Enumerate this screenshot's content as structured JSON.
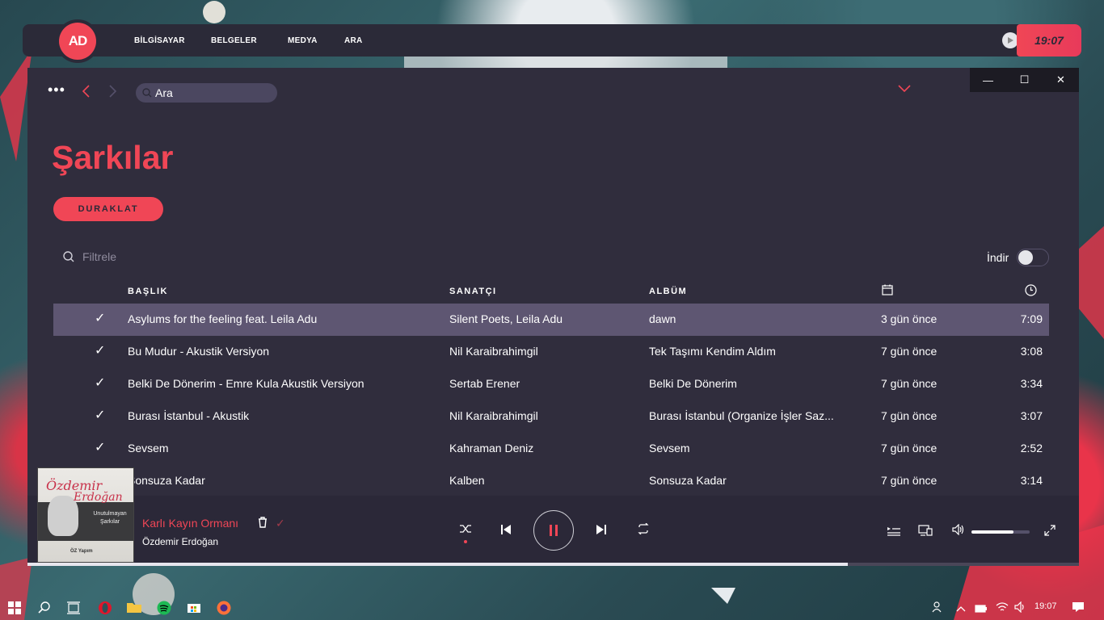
{
  "dock": {
    "logo_text": "AD",
    "menu": [
      "BİLGİSAYAR",
      "BELGELER",
      "MEDYA",
      "ARA"
    ],
    "clock": "19:07"
  },
  "window": {
    "search_value": "Ara",
    "title": "Şarkılar",
    "pause_label": "DURAKLAT",
    "filter_placeholder": "Filtrele",
    "download_label": "İndir",
    "columns": {
      "title": "BAŞLIK",
      "artist": "SANATÇI",
      "album": "ALBÜM"
    },
    "rows": [
      {
        "title": "Asylums for the feeling feat. Leila Adu",
        "artist": "Silent Poets, Leila Adu",
        "album": "dawn",
        "added": "3 gün önce",
        "duration": "7:09"
      },
      {
        "title": "Bu Mudur - Akustik Versiyon",
        "artist": "Nil Karaibrahimgil",
        "album": "Tek Taşımı Kendim Aldım",
        "added": "7 gün önce",
        "duration": "3:08"
      },
      {
        "title": "Belki De Dönerim - Emre Kula Akustik Versiyon",
        "artist": "Sertab Erener",
        "album": "Belki De Dönerim",
        "added": "7 gün önce",
        "duration": "3:34"
      },
      {
        "title": "Burası İstanbul - Akustik",
        "artist": "Nil Karaibrahimgil",
        "album": "Burası İstanbul (Organize İşler Saz...",
        "added": "7 gün önce",
        "duration": "3:07"
      },
      {
        "title": "Sevsem",
        "artist": "Kahraman Deniz",
        "album": "Sevsem",
        "added": "7 gün önce",
        "duration": "2:52"
      },
      {
        "title": "Sonsuza Kadar",
        "artist": "Kalben",
        "album": "Sonsuza Kadar",
        "added": "7 gün önce",
        "duration": "3:14"
      }
    ]
  },
  "player": {
    "track_title": "Karlı Kayın Ormanı",
    "track_artist": "Özdemir Erdoğan",
    "cover_text1": "Özdemir",
    "cover_text2": "Erdoğan",
    "cover_sub": "Unutulmayan Şarkılar",
    "cover_brand": "ÖZ Yapım",
    "progress": 0.78,
    "volume": 0.72
  },
  "taskbar": {
    "time": "19:07"
  },
  "colors": {
    "accent": "#f04656",
    "window_bg": "#302d3d",
    "selected_row": "#5e5672"
  }
}
